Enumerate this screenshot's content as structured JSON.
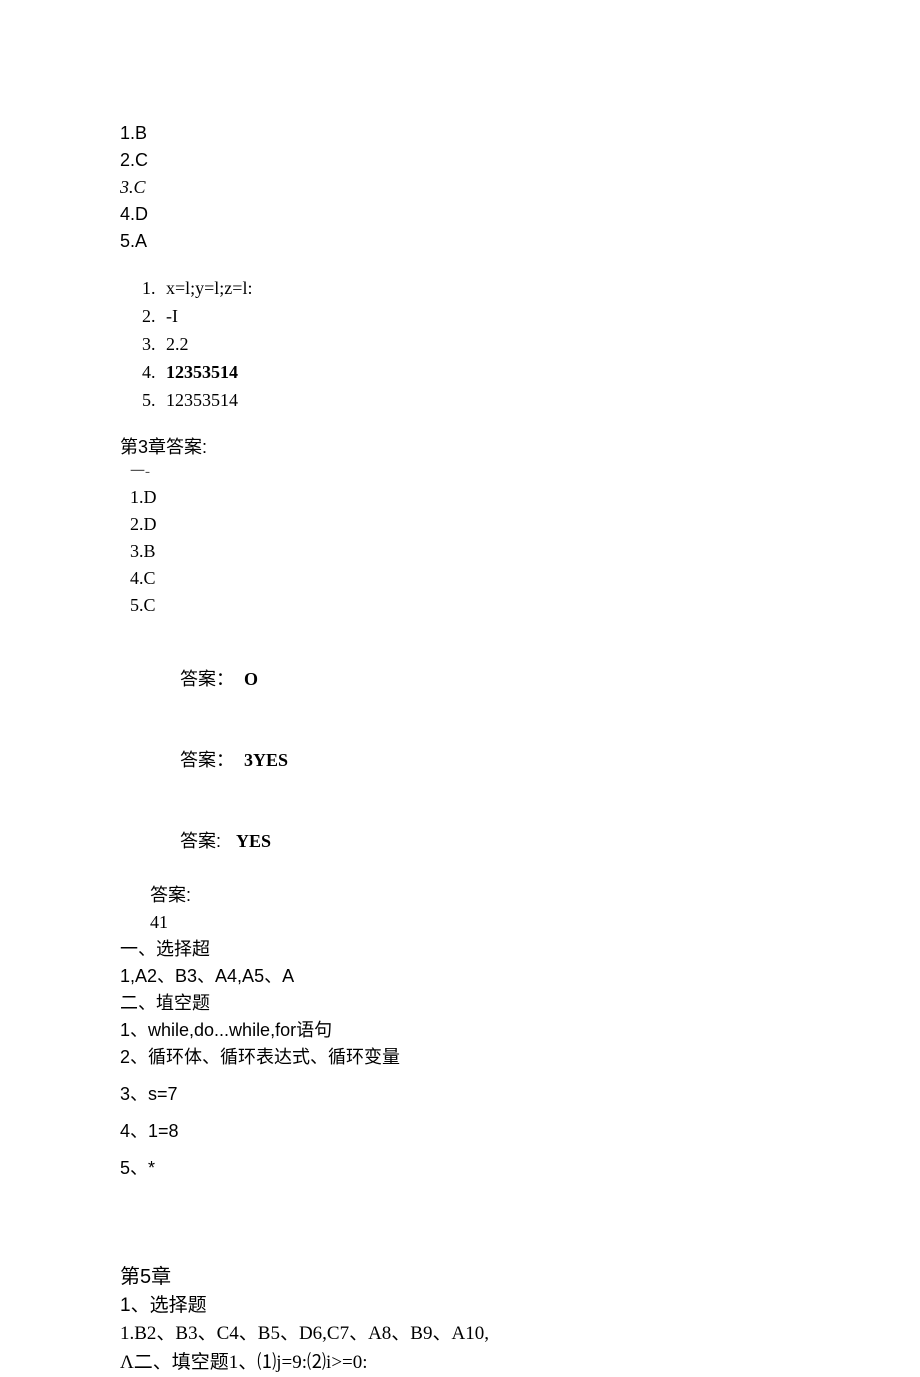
{
  "block1": {
    "l1": "1.B",
    "l2": "2.C",
    "l3": "3.C",
    "l4": "4.D",
    "l5": "5.A"
  },
  "block2": {
    "i1": "x=l;y=l;z=l:",
    "i2": "-I",
    "i3": "2.2",
    "i4": "12353514",
    "i5": "12353514"
  },
  "ch3": {
    "title": "第3章答案:",
    "dash": "一-",
    "a1": "1.D",
    "a2": "2.D",
    "a3": "3.B",
    "a4": "4.C",
    "a5": "5.C"
  },
  "answers": {
    "l1_label": "答案：",
    "l1_val": "O",
    "l2_label": "答案：",
    "l2_val": "3YES",
    "l3_label": "答案:",
    "l3_val": "YES",
    "l4_label": "答案:",
    "l5": "41"
  },
  "sel": {
    "title": "一、选择超",
    "line": "1,A2、B3、A4,A5、A"
  },
  "fill": {
    "title": "二、埴空题",
    "l1": "1、while,do...while,for语句",
    "l2": "2、循环体、循环表达式、循环变量",
    "l3": "3、s=7",
    "l4": "4、1=8",
    "l5": "5、*"
  },
  "ch5": {
    "title": "第5章",
    "s1": "1、选择题",
    "s2": "1.B2、B3、C4、B5、D6,C7、A8、B9、A10,",
    "s3": "Λ二、填空题1、⑴j=9:⑵i>=0:"
  }
}
